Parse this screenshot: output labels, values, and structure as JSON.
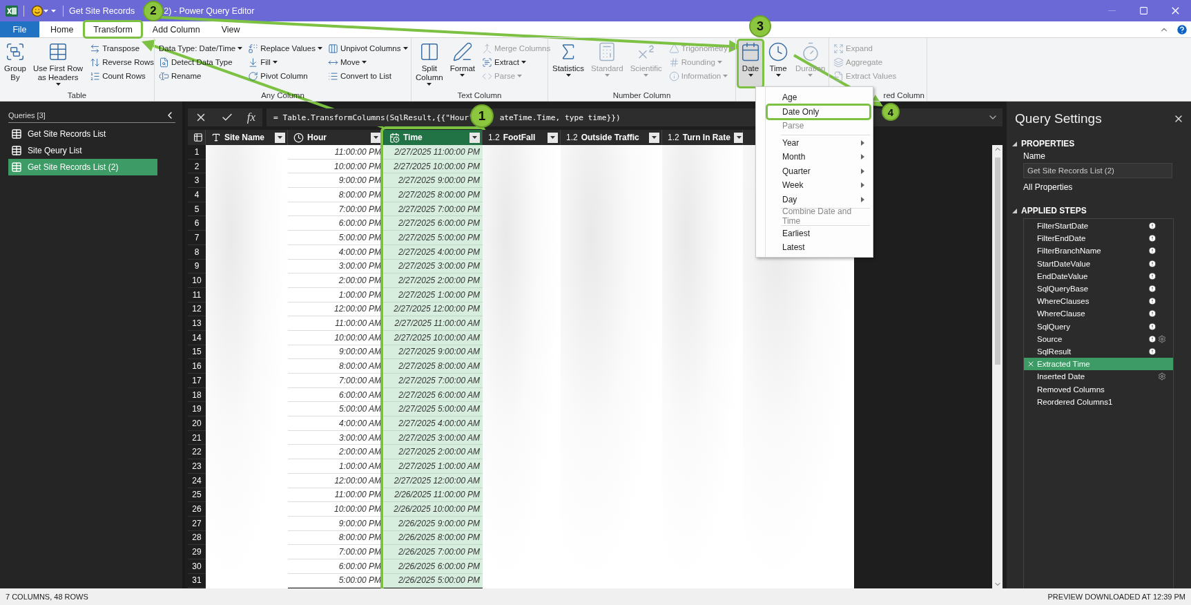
{
  "title_bar": {
    "title_parts": [
      "Get Site Records",
      "2) - Power Query Editor"
    ]
  },
  "ribbon_tabs": [
    {
      "kind": "file",
      "label": "File",
      "selected": false,
      "highlighted": false
    },
    {
      "kind": "tab",
      "label": "Home",
      "selected": false,
      "highlighted": false
    },
    {
      "kind": "tab",
      "label": "Transform",
      "selected": true,
      "highlighted": true
    },
    {
      "kind": "tab",
      "label": "Add Column",
      "selected": false,
      "highlighted": false
    },
    {
      "kind": "tab",
      "label": "View",
      "selected": false,
      "highlighted": false
    }
  ],
  "ribbon_groups": [
    {
      "label": "Table",
      "buttons": [
        {
          "kind": "large",
          "label": "Group\nBy",
          "dropdown": false,
          "disabled": false,
          "pressed": false,
          "highlighted": false
        },
        {
          "kind": "large",
          "label": "Use First Row\nas Headers",
          "dropdown": true,
          "disabled": false,
          "pressed": false,
          "highlighted": false
        },
        {
          "kind": "small",
          "label": "Transpose",
          "dropdown": false,
          "disabled": false,
          "highlighted": false
        },
        {
          "kind": "small",
          "label": "Reverse Rows",
          "dropdown": false,
          "disabled": false,
          "highlighted": false
        },
        {
          "kind": "small",
          "label": "Count Rows",
          "dropdown": false,
          "disabled": false,
          "highlighted": false
        }
      ]
    },
    {
      "label": "Any Column",
      "buttons": [
        {
          "kind": "small",
          "label": "Data Type: Date/Time",
          "dropdown": true,
          "disabled": false,
          "highlighted": false
        },
        {
          "kind": "small",
          "label": "Detect Data Type",
          "dropdown": false,
          "disabled": false,
          "highlighted": false
        },
        {
          "kind": "small",
          "label": "Rename",
          "dropdown": false,
          "disabled": false,
          "highlighted": false
        },
        {
          "kind": "small",
          "label": "Replace Values",
          "dropdown": true,
          "disabled": false,
          "highlighted": false
        },
        {
          "kind": "small",
          "label": "Fill",
          "dropdown": true,
          "disabled": false,
          "highlighted": false
        },
        {
          "kind": "small",
          "label": "Pivot Column",
          "dropdown": false,
          "disabled": false,
          "highlighted": false
        },
        {
          "kind": "small",
          "label": "Unpivot Columns",
          "dropdown": true,
          "disabled": false,
          "highlighted": false
        },
        {
          "kind": "small",
          "label": "Move",
          "dropdown": true,
          "disabled": false,
          "highlighted": false
        },
        {
          "kind": "small",
          "label": "Convert to List",
          "dropdown": false,
          "disabled": false,
          "highlighted": false
        }
      ]
    },
    {
      "label": "Text Column",
      "buttons": [
        {
          "kind": "large",
          "label": "Split\nColumn",
          "dropdown": true,
          "disabled": false,
          "pressed": false,
          "highlighted": false
        },
        {
          "kind": "large",
          "label": "Format",
          "dropdown": true,
          "disabled": false,
          "pressed": false,
          "highlighted": false
        },
        {
          "kind": "small",
          "label": "Merge Columns",
          "dropdown": false,
          "disabled": true,
          "highlighted": false
        },
        {
          "kind": "small",
          "label": "Extract",
          "dropdown": true,
          "disabled": false,
          "highlighted": false
        },
        {
          "kind": "small",
          "label": "Parse",
          "dropdown": true,
          "disabled": true,
          "highlighted": false
        }
      ]
    },
    {
      "label": "Number Column",
      "buttons": [
        {
          "kind": "large",
          "label": "Statistics",
          "dropdown": true,
          "disabled": false,
          "pressed": false,
          "highlighted": false
        },
        {
          "kind": "large",
          "label": "Standard",
          "dropdown": true,
          "disabled": true,
          "pressed": false,
          "highlighted": false
        },
        {
          "kind": "large",
          "label": "Scientific",
          "dropdown": true,
          "disabled": true,
          "pressed": false,
          "highlighted": false
        },
        {
          "kind": "small",
          "label": "Trigonometry",
          "dropdown": true,
          "disabled": true,
          "highlighted": false
        },
        {
          "kind": "small",
          "label": "Rounding",
          "dropdown": true,
          "disabled": true,
          "highlighted": false
        },
        {
          "kind": "small",
          "label": "Information",
          "dropdown": true,
          "disabled": true,
          "highlighted": false
        }
      ]
    },
    {
      "buttons": [
        {
          "kind": "large",
          "label": "Date",
          "dropdown": true,
          "disabled": false,
          "pressed": true,
          "highlighted": true
        },
        {
          "kind": "large",
          "label": "Time",
          "dropdown": true,
          "disabled": false,
          "pressed": false,
          "highlighted": false
        },
        {
          "kind": "large",
          "label": "Duration",
          "dropdown": true,
          "disabled": true,
          "pressed": false,
          "highlighted": false
        }
      ]
    },
    {
      "label": "red Column",
      "buttons": [
        {
          "kind": "small",
          "label": "Expand",
          "dropdown": false,
          "disabled": true,
          "highlighted": false
        },
        {
          "kind": "small",
          "label": "Aggregate",
          "dropdown": false,
          "disabled": true,
          "highlighted": false
        },
        {
          "kind": "small",
          "label": "Extract Values",
          "dropdown": false,
          "disabled": true,
          "highlighted": false
        }
      ]
    }
  ],
  "queries": {
    "header": "Queries [3]",
    "items": [
      {
        "label": "Get Site Records List",
        "selected": false
      },
      {
        "label": "Site Qeury List",
        "selected": false
      },
      {
        "label": "Get Site Records List (2)",
        "selected": true
      }
    ]
  },
  "formula_bar": {
    "fx": "fx",
    "formula_parts": [
      "= Table.TransformColumns(SqlResult,{{\"Hour\"",
      "ateTime.Time, type time}})"
    ]
  },
  "table": {
    "columns": [
      {
        "kind": "text",
        "label": "Site Name",
        "selected": false,
        "blurred": true,
        "highlighted": false
      },
      {
        "kind": "time",
        "label": "Hour",
        "selected": false,
        "blurred": false,
        "highlighted": false
      },
      {
        "kind": "datetime",
        "label": "Time",
        "selected": true,
        "blurred": false,
        "highlighted": true
      },
      {
        "kind": "decimal",
        "type_label": "1.2",
        "label": "FootFall",
        "selected": false,
        "blurred": true,
        "highlighted": false
      },
      {
        "kind": "decimal",
        "type_label": "1.2",
        "label": "Outside Traffic",
        "selected": false,
        "blurred": true,
        "highlighted": false
      },
      {
        "kind": "decimal",
        "type_label": "1.2",
        "label": "Turn In Rate",
        "selected": false,
        "blurred": true,
        "highlighted": false
      }
    ],
    "rows": [
      {
        "number": "1",
        "hour": "11:00:00 PM",
        "time": "2/27/2025 11:00:00 PM"
      },
      {
        "number": "2",
        "hour": "10:00:00 PM",
        "time": "2/27/2025 10:00:00 PM"
      },
      {
        "number": "3",
        "hour": "9:00:00 PM",
        "time": "2/27/2025 9:00:00 PM"
      },
      {
        "number": "4",
        "hour": "8:00:00 PM",
        "time": "2/27/2025 8:00:00 PM"
      },
      {
        "number": "5",
        "hour": "7:00:00 PM",
        "time": "2/27/2025 7:00:00 PM"
      },
      {
        "number": "6",
        "hour": "6:00:00 PM",
        "time": "2/27/2025 6:00:00 PM"
      },
      {
        "number": "7",
        "hour": "5:00:00 PM",
        "time": "2/27/2025 5:00:00 PM"
      },
      {
        "number": "8",
        "hour": "4:00:00 PM",
        "time": "2/27/2025 4:00:00 PM"
      },
      {
        "number": "9",
        "hour": "3:00:00 PM",
        "time": "2/27/2025 3:00:00 PM"
      },
      {
        "number": "10",
        "hour": "2:00:00 PM",
        "time": "2/27/2025 2:00:00 PM"
      },
      {
        "number": "11",
        "hour": "1:00:00 PM",
        "time": "2/27/2025 1:00:00 PM"
      },
      {
        "number": "12",
        "hour": "12:00:00 PM",
        "time": "2/27/2025 12:00:00 PM"
      },
      {
        "number": "13",
        "hour": "11:00:00 AM",
        "time": "2/27/2025 11:00:00 AM"
      },
      {
        "number": "14",
        "hour": "10:00:00 AM",
        "time": "2/27/2025 10:00:00 AM"
      },
      {
        "number": "15",
        "hour": "9:00:00 AM",
        "time": "2/27/2025 9:00:00 AM"
      },
      {
        "number": "16",
        "hour": "8:00:00 AM",
        "time": "2/27/2025 8:00:00 AM"
      },
      {
        "number": "17",
        "hour": "7:00:00 AM",
        "time": "2/27/2025 7:00:00 AM"
      },
      {
        "number": "18",
        "hour": "6:00:00 AM",
        "time": "2/27/2025 6:00:00 AM"
      },
      {
        "number": "19",
        "hour": "5:00:00 AM",
        "time": "2/27/2025 5:00:00 AM"
      },
      {
        "number": "20",
        "hour": "4:00:00 AM",
        "time": "2/27/2025 4:00:00 AM"
      },
      {
        "number": "21",
        "hour": "3:00:00 AM",
        "time": "2/27/2025 3:00:00 AM"
      },
      {
        "number": "22",
        "hour": "2:00:00 AM",
        "time": "2/27/2025 2:00:00 AM"
      },
      {
        "number": "23",
        "hour": "1:00:00 AM",
        "time": "2/27/2025 1:00:00 AM"
      },
      {
        "number": "24",
        "hour": "12:00:00 AM",
        "time": "2/27/2025 12:00:00 AM"
      },
      {
        "number": "25",
        "hour": "11:00:00 PM",
        "time": "2/26/2025 11:00:00 PM"
      },
      {
        "number": "26",
        "hour": "10:00:00 PM",
        "time": "2/26/2025 10:00:00 PM"
      },
      {
        "number": "27",
        "hour": "9:00:00 PM",
        "time": "2/26/2025 9:00:00 PM"
      },
      {
        "number": "28",
        "hour": "8:00:00 PM",
        "time": "2/26/2025 8:00:00 PM"
      },
      {
        "number": "29",
        "hour": "7:00:00 PM",
        "time": "2/26/2025 7:00:00 PM"
      },
      {
        "number": "30",
        "hour": "6:00:00 PM",
        "time": "2/26/2025 6:00:00 PM"
      },
      {
        "number": "31",
        "hour": "5:00:00 PM",
        "time": "2/26/2025 5:00:00 PM"
      }
    ]
  },
  "date_menu": {
    "items": [
      {
        "kind": "item",
        "label": "Age",
        "disabled": false,
        "submenu": false,
        "highlighted": false
      },
      {
        "kind": "item",
        "label": "Date Only",
        "disabled": false,
        "submenu": false,
        "highlighted": true
      },
      {
        "kind": "item",
        "label": "Parse",
        "disabled": true,
        "submenu": false,
        "highlighted": false
      },
      {
        "kind": "separator"
      },
      {
        "kind": "item",
        "label": "Year",
        "disabled": false,
        "submenu": true,
        "highlighted": false
      },
      {
        "kind": "item",
        "label": "Month",
        "disabled": false,
        "submenu": true,
        "highlighted": false
      },
      {
        "kind": "item",
        "label": "Quarter",
        "disabled": false,
        "submenu": true,
        "highlighted": false
      },
      {
        "kind": "item",
        "label": "Week",
        "disabled": false,
        "submenu": true,
        "highlighted": false
      },
      {
        "kind": "item",
        "label": "Day",
        "disabled": false,
        "submenu": true,
        "highlighted": false
      },
      {
        "kind": "separator"
      },
      {
        "kind": "item",
        "label": "Combine Date and Time",
        "disabled": true,
        "submenu": false,
        "highlighted": false
      },
      {
        "kind": "separator"
      },
      {
        "kind": "item",
        "label": "Earliest",
        "disabled": false,
        "submenu": false,
        "highlighted": false
      },
      {
        "kind": "item",
        "label": "Latest",
        "disabled": false,
        "submenu": false,
        "highlighted": false
      }
    ]
  },
  "query_settings": {
    "title": "Query Settings",
    "properties_heading": "PROPERTIES",
    "name_label": "Name",
    "name_value": "Get Site Records List (2)",
    "all_properties": "All Properties",
    "steps_heading": "APPLIED STEPS",
    "steps": [
      {
        "label": "FilterStartDate",
        "selected": false,
        "info": true,
        "settings": false
      },
      {
        "label": "FilterEndDate",
        "selected": false,
        "info": true,
        "settings": false
      },
      {
        "label": "FilterBranchName",
        "selected": false,
        "info": true,
        "settings": false
      },
      {
        "label": "StartDateValue",
        "selected": false,
        "info": true,
        "settings": false
      },
      {
        "label": "EndDateValue",
        "selected": false,
        "info": true,
        "settings": false
      },
      {
        "label": "SqlQueryBase",
        "selected": false,
        "info": true,
        "settings": false
      },
      {
        "label": "WhereClauses",
        "selected": false,
        "info": true,
        "settings": false
      },
      {
        "label": "WhereClause",
        "selected": false,
        "info": true,
        "settings": false
      },
      {
        "label": "SqlQuery",
        "selected": false,
        "info": true,
        "settings": false
      },
      {
        "label": "Source",
        "selected": false,
        "info": true,
        "settings": true
      },
      {
        "label": "SqlResult",
        "selected": false,
        "info": true,
        "settings": false
      },
      {
        "label": "Extracted Time",
        "selected": true,
        "info": false,
        "settings": false
      },
      {
        "label": "Inserted Date",
        "selected": false,
        "info": false,
        "settings": true
      },
      {
        "label": "Removed Columns",
        "selected": false,
        "info": false,
        "settings": false
      },
      {
        "label": "Reordered Columns1",
        "selected": false,
        "info": false,
        "settings": false
      }
    ]
  },
  "status_bar": {
    "left": "7 COLUMNS, 48 ROWS",
    "right": "PREVIEW DOWNLOADED AT 12:39 PM"
  },
  "annotations": {
    "badges": [
      "1",
      "2",
      "3",
      "4"
    ]
  }
}
